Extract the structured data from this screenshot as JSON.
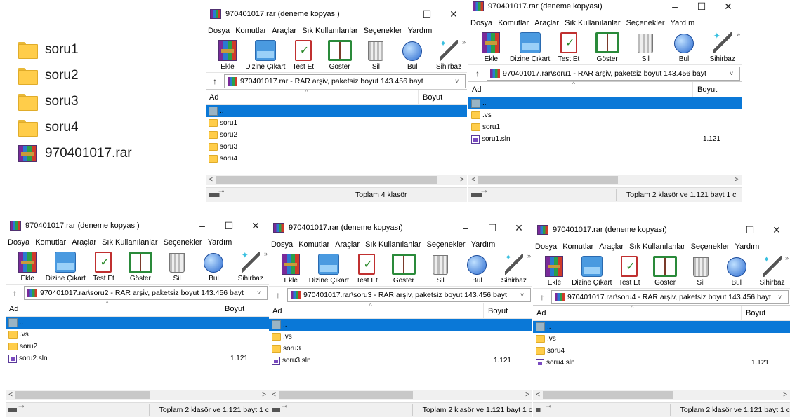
{
  "desktop": {
    "items": [
      {
        "label": "soru1"
      },
      {
        "label": "soru2"
      },
      {
        "label": "soru3"
      },
      {
        "label": "soru4"
      },
      {
        "label": "970401017.rar"
      }
    ]
  },
  "common": {
    "title": "970401017.rar (deneme kopyası)",
    "minimize": "–",
    "maximize": "☐",
    "close": "✕",
    "menu": [
      "Dosya",
      "Komutlar",
      "Araçlar",
      "Sık Kullanılanlar",
      "Seçenekler",
      "Yardım"
    ],
    "toolbar": [
      "Ekle",
      "Dizine Çıkart",
      "Test Et",
      "Göster",
      "Sil",
      "Bul",
      "Sihirbaz"
    ],
    "up_arrow": "↑",
    "col_name": "Ad",
    "col_size": "Boyut",
    "sort_arrow": "^",
    "scroll_left": "<",
    "scroll_right": ">"
  },
  "windows": [
    {
      "address": "970401017.rar - RAR arşiv, paketsiz boyut 143.456 bayt",
      "rows": [
        {
          "name": "..",
          "type": "up",
          "size": ""
        },
        {
          "name": "soru1",
          "type": "folder",
          "size": ""
        },
        {
          "name": "soru2",
          "type": "folder",
          "size": ""
        },
        {
          "name": "soru3",
          "type": "folder",
          "size": ""
        },
        {
          "name": "soru4",
          "type": "folder",
          "size": ""
        }
      ],
      "status": "Toplam 4 klasör"
    },
    {
      "address": "970401017.rar\\soru1 - RAR arşiv, paketsiz boyut 143.456 bayt",
      "rows": [
        {
          "name": "..",
          "type": "up",
          "size": ""
        },
        {
          "name": ".vs",
          "type": "folder",
          "size": ""
        },
        {
          "name": "soru1",
          "type": "folder",
          "size": ""
        },
        {
          "name": "soru1.sln",
          "type": "sln",
          "size": "1.121"
        }
      ],
      "status": "Toplam 2 klasör ve 1.121 bayt 1 c"
    },
    {
      "address": "970401017.rar\\soru2 - RAR arşiv, paketsiz boyut 143.456 bayt",
      "rows": [
        {
          "name": "..",
          "type": "up",
          "size": ""
        },
        {
          "name": ".vs",
          "type": "folder",
          "size": ""
        },
        {
          "name": "soru2",
          "type": "folder",
          "size": ""
        },
        {
          "name": "soru2.sln",
          "type": "sln",
          "size": "1.121"
        }
      ],
      "status": "Toplam 2 klasör ve 1.121 bayt 1 c"
    },
    {
      "address": "970401017.rar\\soru3 - RAR arşiv, paketsiz boyut 143.456 bayt",
      "rows": [
        {
          "name": "..",
          "type": "up",
          "size": ""
        },
        {
          "name": ".vs",
          "type": "folder",
          "size": ""
        },
        {
          "name": "soru3",
          "type": "folder",
          "size": ""
        },
        {
          "name": "soru3.sln",
          "type": "sln",
          "size": "1.121"
        }
      ],
      "status": "Toplam 2 klasör ve 1.121 bayt 1 c"
    },
    {
      "address": "970401017.rar\\soru4 - RAR arşiv, paketsiz boyut 143.456 bayt",
      "rows": [
        {
          "name": "..",
          "type": "up",
          "size": ""
        },
        {
          "name": ".vs",
          "type": "folder",
          "size": ""
        },
        {
          "name": "soru4",
          "type": "folder",
          "size": ""
        },
        {
          "name": "soru4.sln",
          "type": "sln",
          "size": "1.121"
        }
      ],
      "status": "Toplam 2 klasör ve 1.121 bayt 1 c"
    }
  ]
}
